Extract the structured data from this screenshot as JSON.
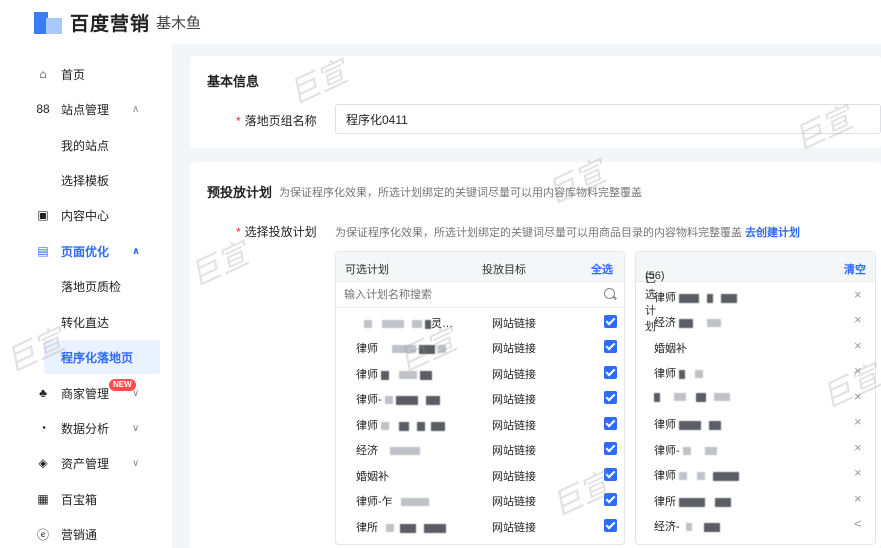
{
  "header": {
    "brand": "百度营销",
    "product": "基木鱼"
  },
  "sidebar": {
    "items": [
      {
        "label": "首页",
        "icon": "home-icon"
      },
      {
        "label": "站点管理",
        "icon": "grid-icon",
        "chevron": "∧"
      },
      {
        "label": "我的站点"
      },
      {
        "label": "选择模板"
      },
      {
        "label": "内容中心",
        "icon": "content-icon"
      },
      {
        "label": "页面优化",
        "icon": "page-optimize-icon",
        "chevron": "∧"
      },
      {
        "label": "落地页质检"
      },
      {
        "label": "转化直达"
      },
      {
        "label": "程序化落地页"
      },
      {
        "label": "商家管理",
        "icon": "merchant-icon",
        "chevron": "∨",
        "badge": "NEW"
      },
      {
        "label": "数据分析",
        "icon": "analytics-icon",
        "chevron": "∨"
      },
      {
        "label": "资产管理",
        "icon": "asset-icon",
        "chevron": "∨"
      },
      {
        "label": "百宝箱",
        "icon": "toolbox-icon"
      },
      {
        "label": "营销通",
        "icon": "marketing-icon"
      }
    ]
  },
  "basic_info": {
    "title": "基本信息",
    "group_name_label": "落地页组名称",
    "group_name_value": "程序化0411"
  },
  "plan_section": {
    "title": "预投放计划",
    "title_hint": "为保证程序化效果，所选计划绑定的关键词尽量可以用内容库物料完整覆盖",
    "select_label": "选择投放计划",
    "select_hint": "为保证程序化效果，所选计划绑定的关键词尽量可以用商品目录的内容物料完整覆盖",
    "create_link": "去创建计划",
    "left_panel": {
      "col_name": "可选计划",
      "col_target": "投放目标",
      "select_all": "全选",
      "search_placeholder": "输入计划名称搜索",
      "rows": [
        {
          "name": "",
          "suffix": "灵…",
          "target": "网站链接"
        },
        {
          "name": "律师",
          "target": "网站链接"
        },
        {
          "name": "律师",
          "target": "网站链接"
        },
        {
          "name": "律师-",
          "target": "网站链接"
        },
        {
          "name": "律师",
          "target": "网站链接"
        },
        {
          "name": "经济",
          "target": "网站链接"
        },
        {
          "name": "婚姻补",
          "target": "网站链接"
        },
        {
          "name": "律师-乍",
          "target": "网站链接"
        },
        {
          "name": "律所",
          "target": "网站链接"
        }
      ]
    },
    "right_panel": {
      "title": "已选计划",
      "count": "(56)",
      "clear": "清空",
      "rows": [
        {
          "name": "律师",
          "action": "×"
        },
        {
          "name": "经济",
          "action": "×"
        },
        {
          "name": "婚姻补",
          "action": "×"
        },
        {
          "name": "律师",
          "action": "×"
        },
        {
          "name": "",
          "action": "×"
        },
        {
          "name": "律师",
          "action": "×"
        },
        {
          "name": "律师-",
          "action": "×"
        },
        {
          "name": "律师",
          "action": "×"
        },
        {
          "name": "律所",
          "action": "×"
        },
        {
          "name": "经济-",
          "action": "<"
        }
      ]
    }
  },
  "watermark": "巨宣"
}
